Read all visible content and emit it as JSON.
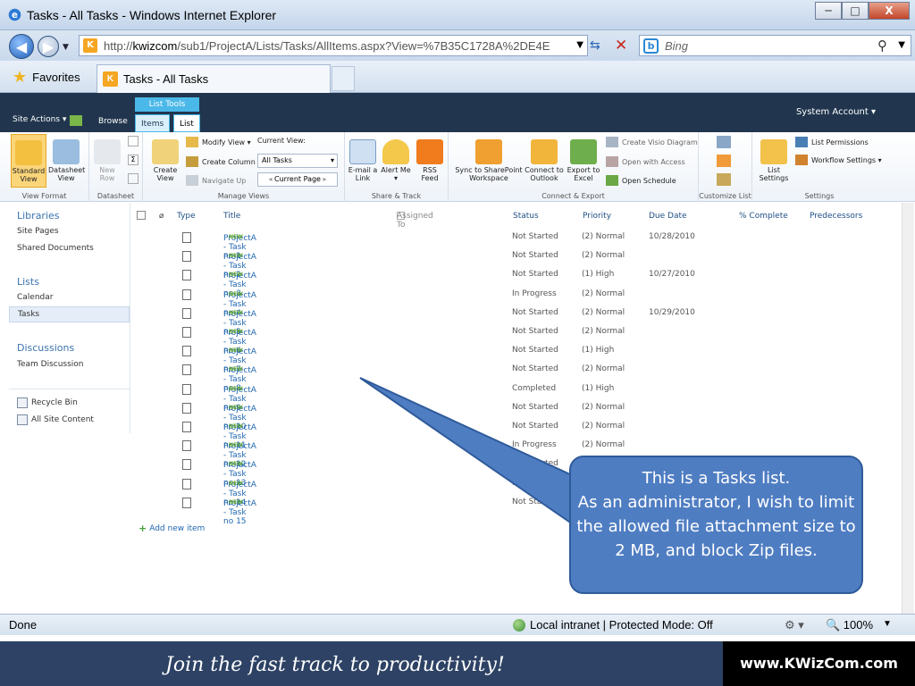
{
  "window": {
    "title": "Tasks - All Tasks - Windows Internet Explorer",
    "min_label": "─",
    "max_label": "□",
    "close_label": "X"
  },
  "address": {
    "url_prefix": "http://",
    "url_host": "kwizcom",
    "url_rest": "/sub1/ProjectA/Lists/Tasks/AllItems.aspx?View=%7B35C1728A%2DE4E0%2",
    "search_placeholder": "Bing"
  },
  "favorites": {
    "label": "Favorites",
    "tab_title": "Tasks - All Tasks"
  },
  "sp_top": {
    "list_tools": "List Tools",
    "tab_items": "Items",
    "tab_list": "List",
    "site_actions": "Site Actions ▾",
    "browse": "Browse",
    "account": "System Account ▾"
  },
  "ribbon": {
    "standard_view": "Standard View",
    "datasheet_view": "Datasheet View",
    "view_format": "View Format",
    "new_row": "New Row",
    "datasheet": "Datasheet",
    "create_view": "Create View",
    "modify_view": "Modify View ▾",
    "create_column": "Create Column",
    "navigate_up": "Navigate Up",
    "current_view_label": "Current View:",
    "current_view_value": "All Tasks",
    "current_page": "Current Page",
    "manage_views": "Manage Views",
    "email_link": "E-mail a Link",
    "alert_me": "Alert Me ▾",
    "rss_feed": "RSS Feed",
    "share_track": "Share & Track",
    "sync_sp": "Sync to SharePoint Workspace",
    "connect_outlook": "Connect to Outlook",
    "export_excel": "Export to Excel",
    "create_visio": "Create Visio Diagram",
    "open_access": "Open with Access",
    "open_schedule": "Open Schedule",
    "connect_export": "Connect & Export",
    "customize_list": "Customize List",
    "list_settings": "List Settings",
    "list_permissions": "List Permissions",
    "workflow_settings": "Workflow Settings ▾",
    "settings": "Settings"
  },
  "leftnav": {
    "libraries": "Libraries",
    "site_pages": "Site Pages",
    "shared_documents": "Shared Documents",
    "lists": "Lists",
    "calendar": "Calendar",
    "tasks": "Tasks",
    "discussions": "Discussions",
    "team_discussion": "Team Discussion",
    "recycle_bin": "Recycle Bin",
    "all_site_content": "All Site Content"
  },
  "table": {
    "headers": {
      "type": "Type",
      "title": "Title",
      "assigned_to": "Assigned To",
      "status": "Status",
      "priority": "Priority",
      "due_date": "Due Date",
      "complete": "% Complete",
      "predecessors": "Predecessors"
    },
    "new_badge": "NEW",
    "rows": [
      {
        "title": "ProjectA - Task no 1",
        "status": "Not Started",
        "priority": "(2) Normal",
        "due": "10/28/2010"
      },
      {
        "title": "ProjectA - Task no 2",
        "status": "Not Started",
        "priority": "(2) Normal",
        "due": ""
      },
      {
        "title": "ProjectA - Task no 3",
        "status": "Not Started",
        "priority": "(1) High",
        "due": "10/27/2010"
      },
      {
        "title": "ProjectA - Task no 4",
        "status": "In Progress",
        "priority": "(2) Normal",
        "due": ""
      },
      {
        "title": "ProjectA - Task no 5",
        "status": "Not Started",
        "priority": "(2) Normal",
        "due": "10/29/2010"
      },
      {
        "title": "ProjectA - Task no 6",
        "status": "Not Started",
        "priority": "(2) Normal",
        "due": ""
      },
      {
        "title": "ProjectA - Task no 7",
        "status": "Not Started",
        "priority": "(1) High",
        "due": ""
      },
      {
        "title": "ProjectA - Task no 8",
        "status": "Not Started",
        "priority": "(2) Normal",
        "due": ""
      },
      {
        "title": "ProjectA - Task no 9",
        "status": "Completed",
        "priority": "(1) High",
        "due": ""
      },
      {
        "title": "ProjectA - Task no 10",
        "status": "Not Started",
        "priority": "(2) Normal",
        "due": ""
      },
      {
        "title": "ProjectA - Task no 11",
        "status": "Not Started",
        "priority": "(2) Normal",
        "due": ""
      },
      {
        "title": "ProjectA - Task no 12",
        "status": "In Progress",
        "priority": "(2) Normal",
        "due": ""
      },
      {
        "title": "ProjectA - Task no 13",
        "status": "Not Started",
        "priority": "",
        "due": ""
      },
      {
        "title": "ProjectA - Task no 14",
        "status": "Not Started",
        "priority": "",
        "due": ""
      },
      {
        "title": "ProjectA - Task no 15",
        "status": "Not Started",
        "priority": "",
        "due": ""
      }
    ],
    "add_new_item": "Add new item"
  },
  "callout": {
    "line1": "This is a Tasks list.",
    "line2": "As an administrator, I wish to limit the allowed file attachment size to 2 MB, and block Zip files."
  },
  "status": {
    "done": "Done",
    "zone": "Local intranet | Protected Mode: Off",
    "zoom": "🔍 100%"
  },
  "footer": {
    "slogan": "Join the fast track to productivity!",
    "brand": "www.KWizCom.com"
  },
  "colors": {
    "sp_dark": "#21364e",
    "sp_accent": "#4ab8e8",
    "callout": "#4f7dc2",
    "link": "#2067b0",
    "footer": "#2d4264"
  }
}
